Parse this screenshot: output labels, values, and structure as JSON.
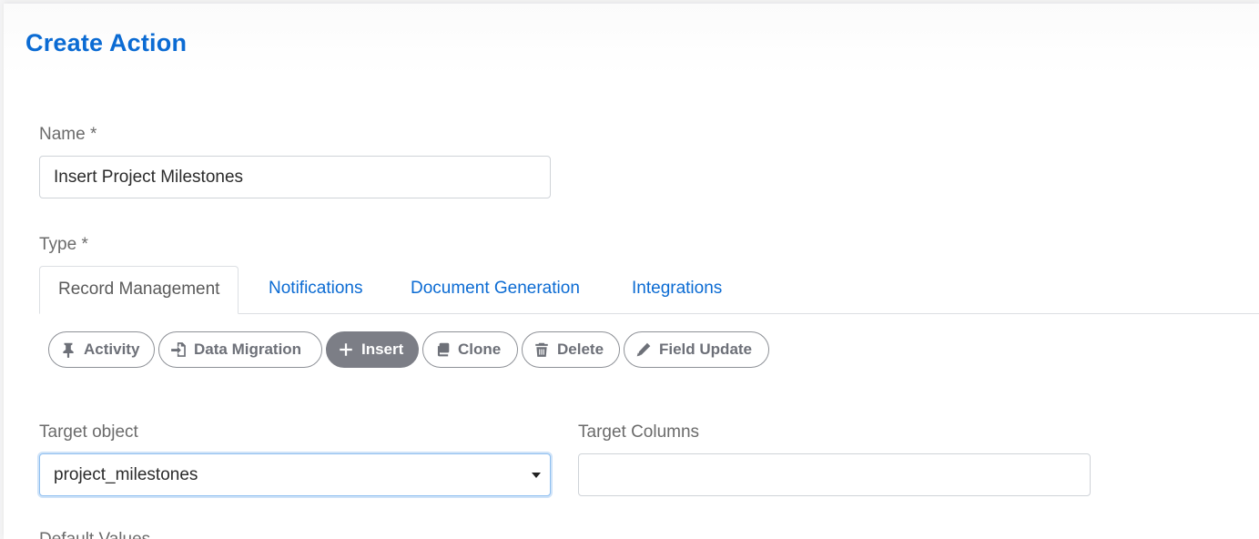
{
  "header": {
    "title": "Create Action"
  },
  "form": {
    "name": {
      "label": "Name *",
      "value": "Insert Project Milestones"
    },
    "type": {
      "label": "Type *",
      "tabs": [
        {
          "label": "Record Management",
          "active": true
        },
        {
          "label": "Notifications",
          "active": false
        },
        {
          "label": "Document Generation",
          "active": false
        },
        {
          "label": "Integrations",
          "active": false
        }
      ],
      "actions": [
        {
          "label": "Activity",
          "icon": "pin-icon",
          "selected": false
        },
        {
          "label": "Data Migration",
          "icon": "import-icon",
          "selected": false
        },
        {
          "label": "Insert",
          "icon": "plus-icon",
          "selected": true
        },
        {
          "label": "Clone",
          "icon": "copy-icon",
          "selected": false
        },
        {
          "label": "Delete",
          "icon": "trash-icon",
          "selected": false
        },
        {
          "label": "Field Update",
          "icon": "pencil-icon",
          "selected": false
        }
      ]
    },
    "target_object": {
      "label": "Target object",
      "value": "project_milestones"
    },
    "target_columns": {
      "label": "Target Columns",
      "value": ""
    },
    "default_values": {
      "label": "Default Values"
    }
  },
  "colors": {
    "accent": "#0b6bd3",
    "chip_selected": "#7c7e86",
    "chip_border": "#8d9096"
  }
}
